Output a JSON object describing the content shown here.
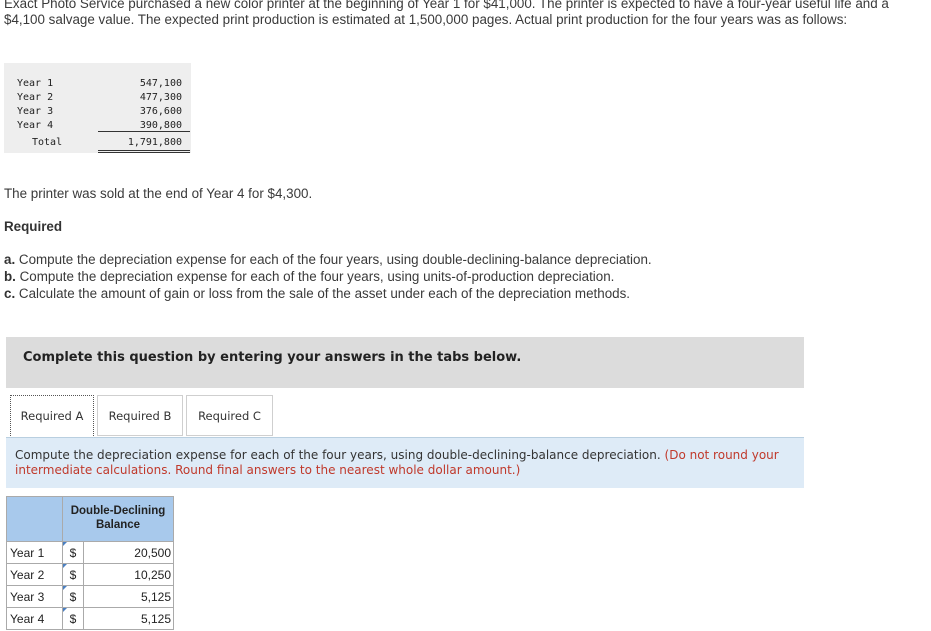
{
  "intro": "Exact Photo Service purchased a new color printer at the beginning of Year 1 for $41,000. The printer is expected to have a four-year useful life and a $4,100 salvage value. The expected print production is estimated at 1,500,000 pages. Actual print production for the four years was as follows:",
  "production": {
    "rows": [
      {
        "label": "Year 1",
        "value": "547,100"
      },
      {
        "label": "Year 2",
        "value": "477,300"
      },
      {
        "label": "Year 3",
        "value": "376,600"
      },
      {
        "label": "Year 4",
        "value": "390,800"
      }
    ],
    "total_label": "Total",
    "total_value": "1,791,800"
  },
  "sold_text": "The printer was sold at the end of Year 4 for $4,300.",
  "required_heading": "Required",
  "requirements": [
    {
      "letter": "a.",
      "text": " Compute the depreciation expense for each of the four years, using double-declining-balance depreciation."
    },
    {
      "letter": "b.",
      "text": " Compute the depreciation expense for each of the four years, using units-of-production depreciation."
    },
    {
      "letter": "c.",
      "text": " Calculate the amount of gain or loss from the sale of the asset under each of the depreciation methods."
    }
  ],
  "banner": "Complete this question by entering your answers in the tabs below.",
  "tabs": [
    {
      "label": "Required A"
    },
    {
      "label": "Required B"
    },
    {
      "label": "Required C"
    }
  ],
  "instruction": {
    "text": "Compute the depreciation expense for each of the four years, using double-declining-balance depreciation.",
    "note": "(Do not round your intermediate calculations. Round final answers to the nearest whole dollar amount.)"
  },
  "ddb_table": {
    "header": "Double-Declining Balance",
    "currency": "$",
    "rows": [
      {
        "label": "Year 1",
        "value": "20,500"
      },
      {
        "label": "Year 2",
        "value": "10,250"
      },
      {
        "label": "Year 3",
        "value": "5,125"
      },
      {
        "label": "Year 4",
        "value": "5,125"
      }
    ]
  },
  "colors": {
    "banner_bg": "#dcdcdc",
    "instruction_bg": "#deebf7",
    "table_header_bg": "#a8c9ec",
    "note_red": "#c0392b"
  }
}
